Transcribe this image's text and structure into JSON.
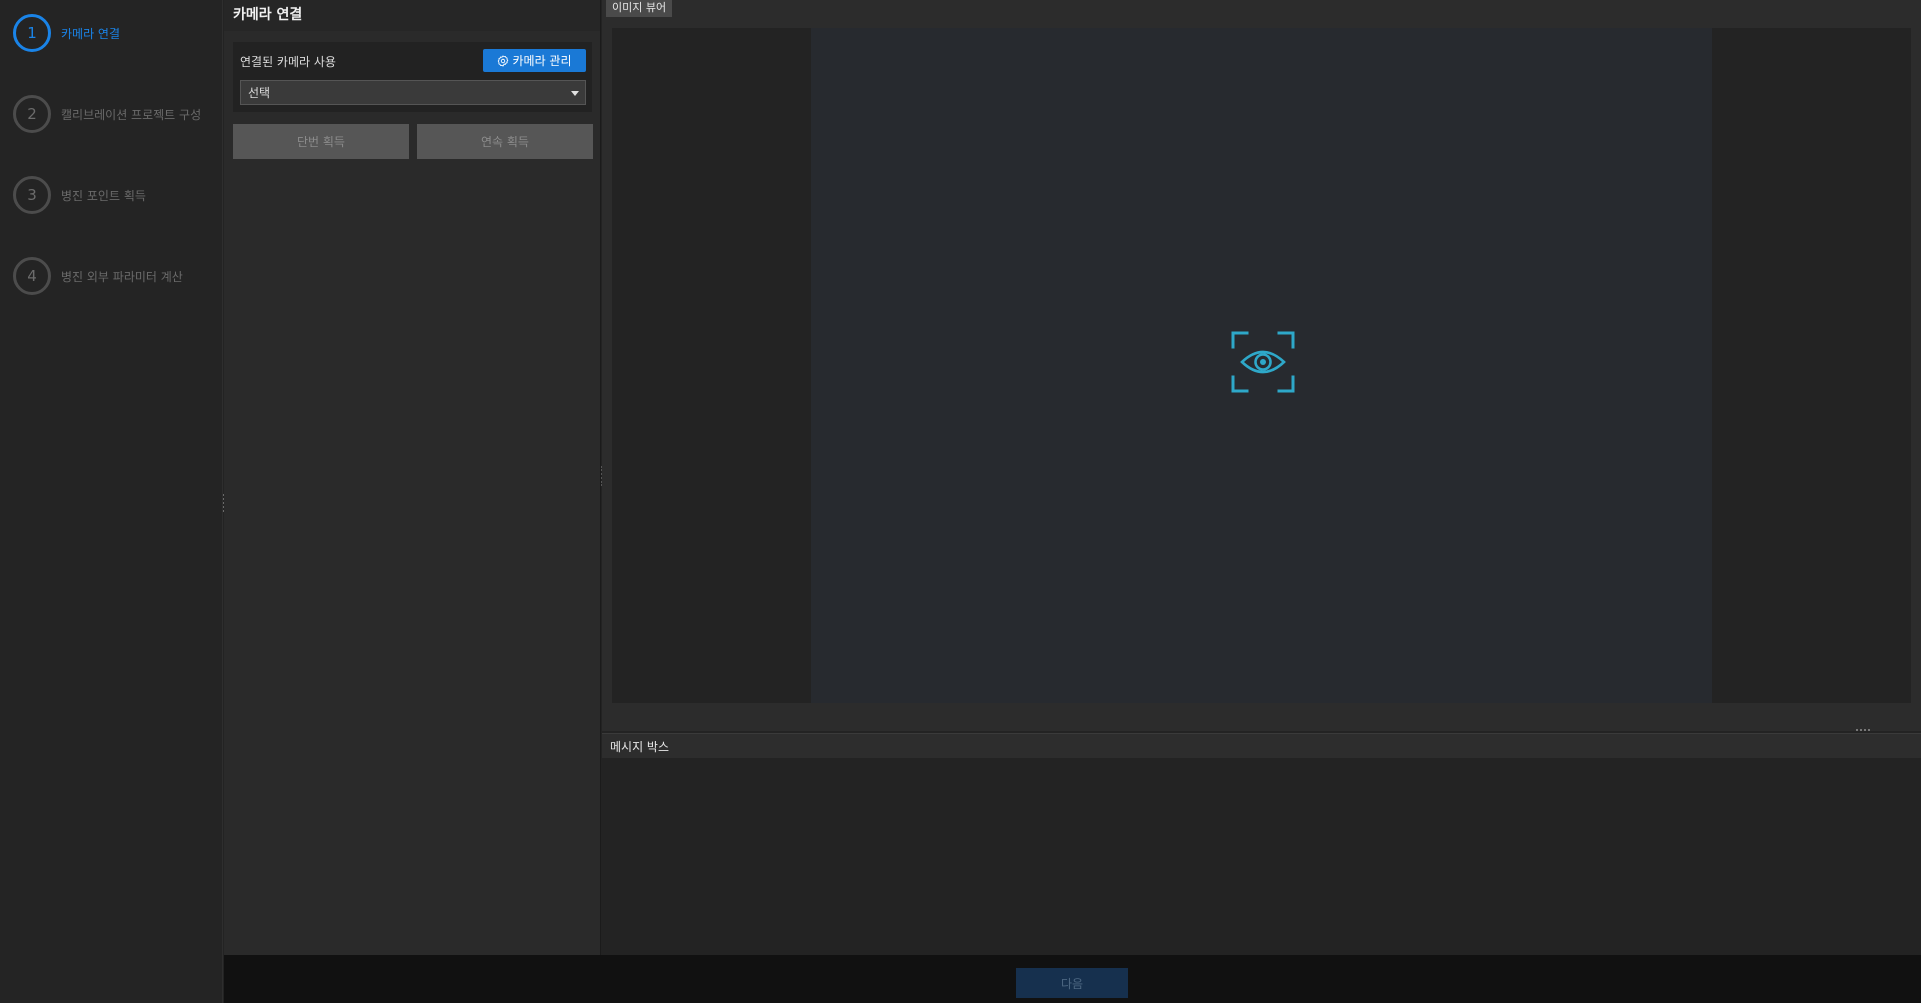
{
  "steps": [
    {
      "number": "1",
      "label": "카메라 연결",
      "active": true
    },
    {
      "number": "2",
      "label": "캘리브레이션 프로젝트 구성",
      "active": false
    },
    {
      "number": "3",
      "label": "병진 포인트 획득",
      "active": false
    },
    {
      "number": "4",
      "label": "병진 외부 파라미터 계산",
      "active": false
    }
  ],
  "panel": {
    "title": "카메라 연결",
    "use_connected_camera_label": "연결된 카메라 사용",
    "camera_manage_label": "카메라 관리",
    "camera_select_value": "선택",
    "single_capture_label": "단번 획득",
    "continuous_capture_label": "연속 획득"
  },
  "viewer": {
    "tab_label": "이미지 뷰어",
    "placeholder_icon": "eye-focus-icon",
    "accent_color": "#2ea8c9"
  },
  "message_box": {
    "title": "메시지 박스"
  },
  "footer": {
    "next_label": "다음"
  },
  "colors": {
    "active_step": "#1a84e8",
    "primary_button": "#1a79d6",
    "disabled_next": "#16304e"
  }
}
